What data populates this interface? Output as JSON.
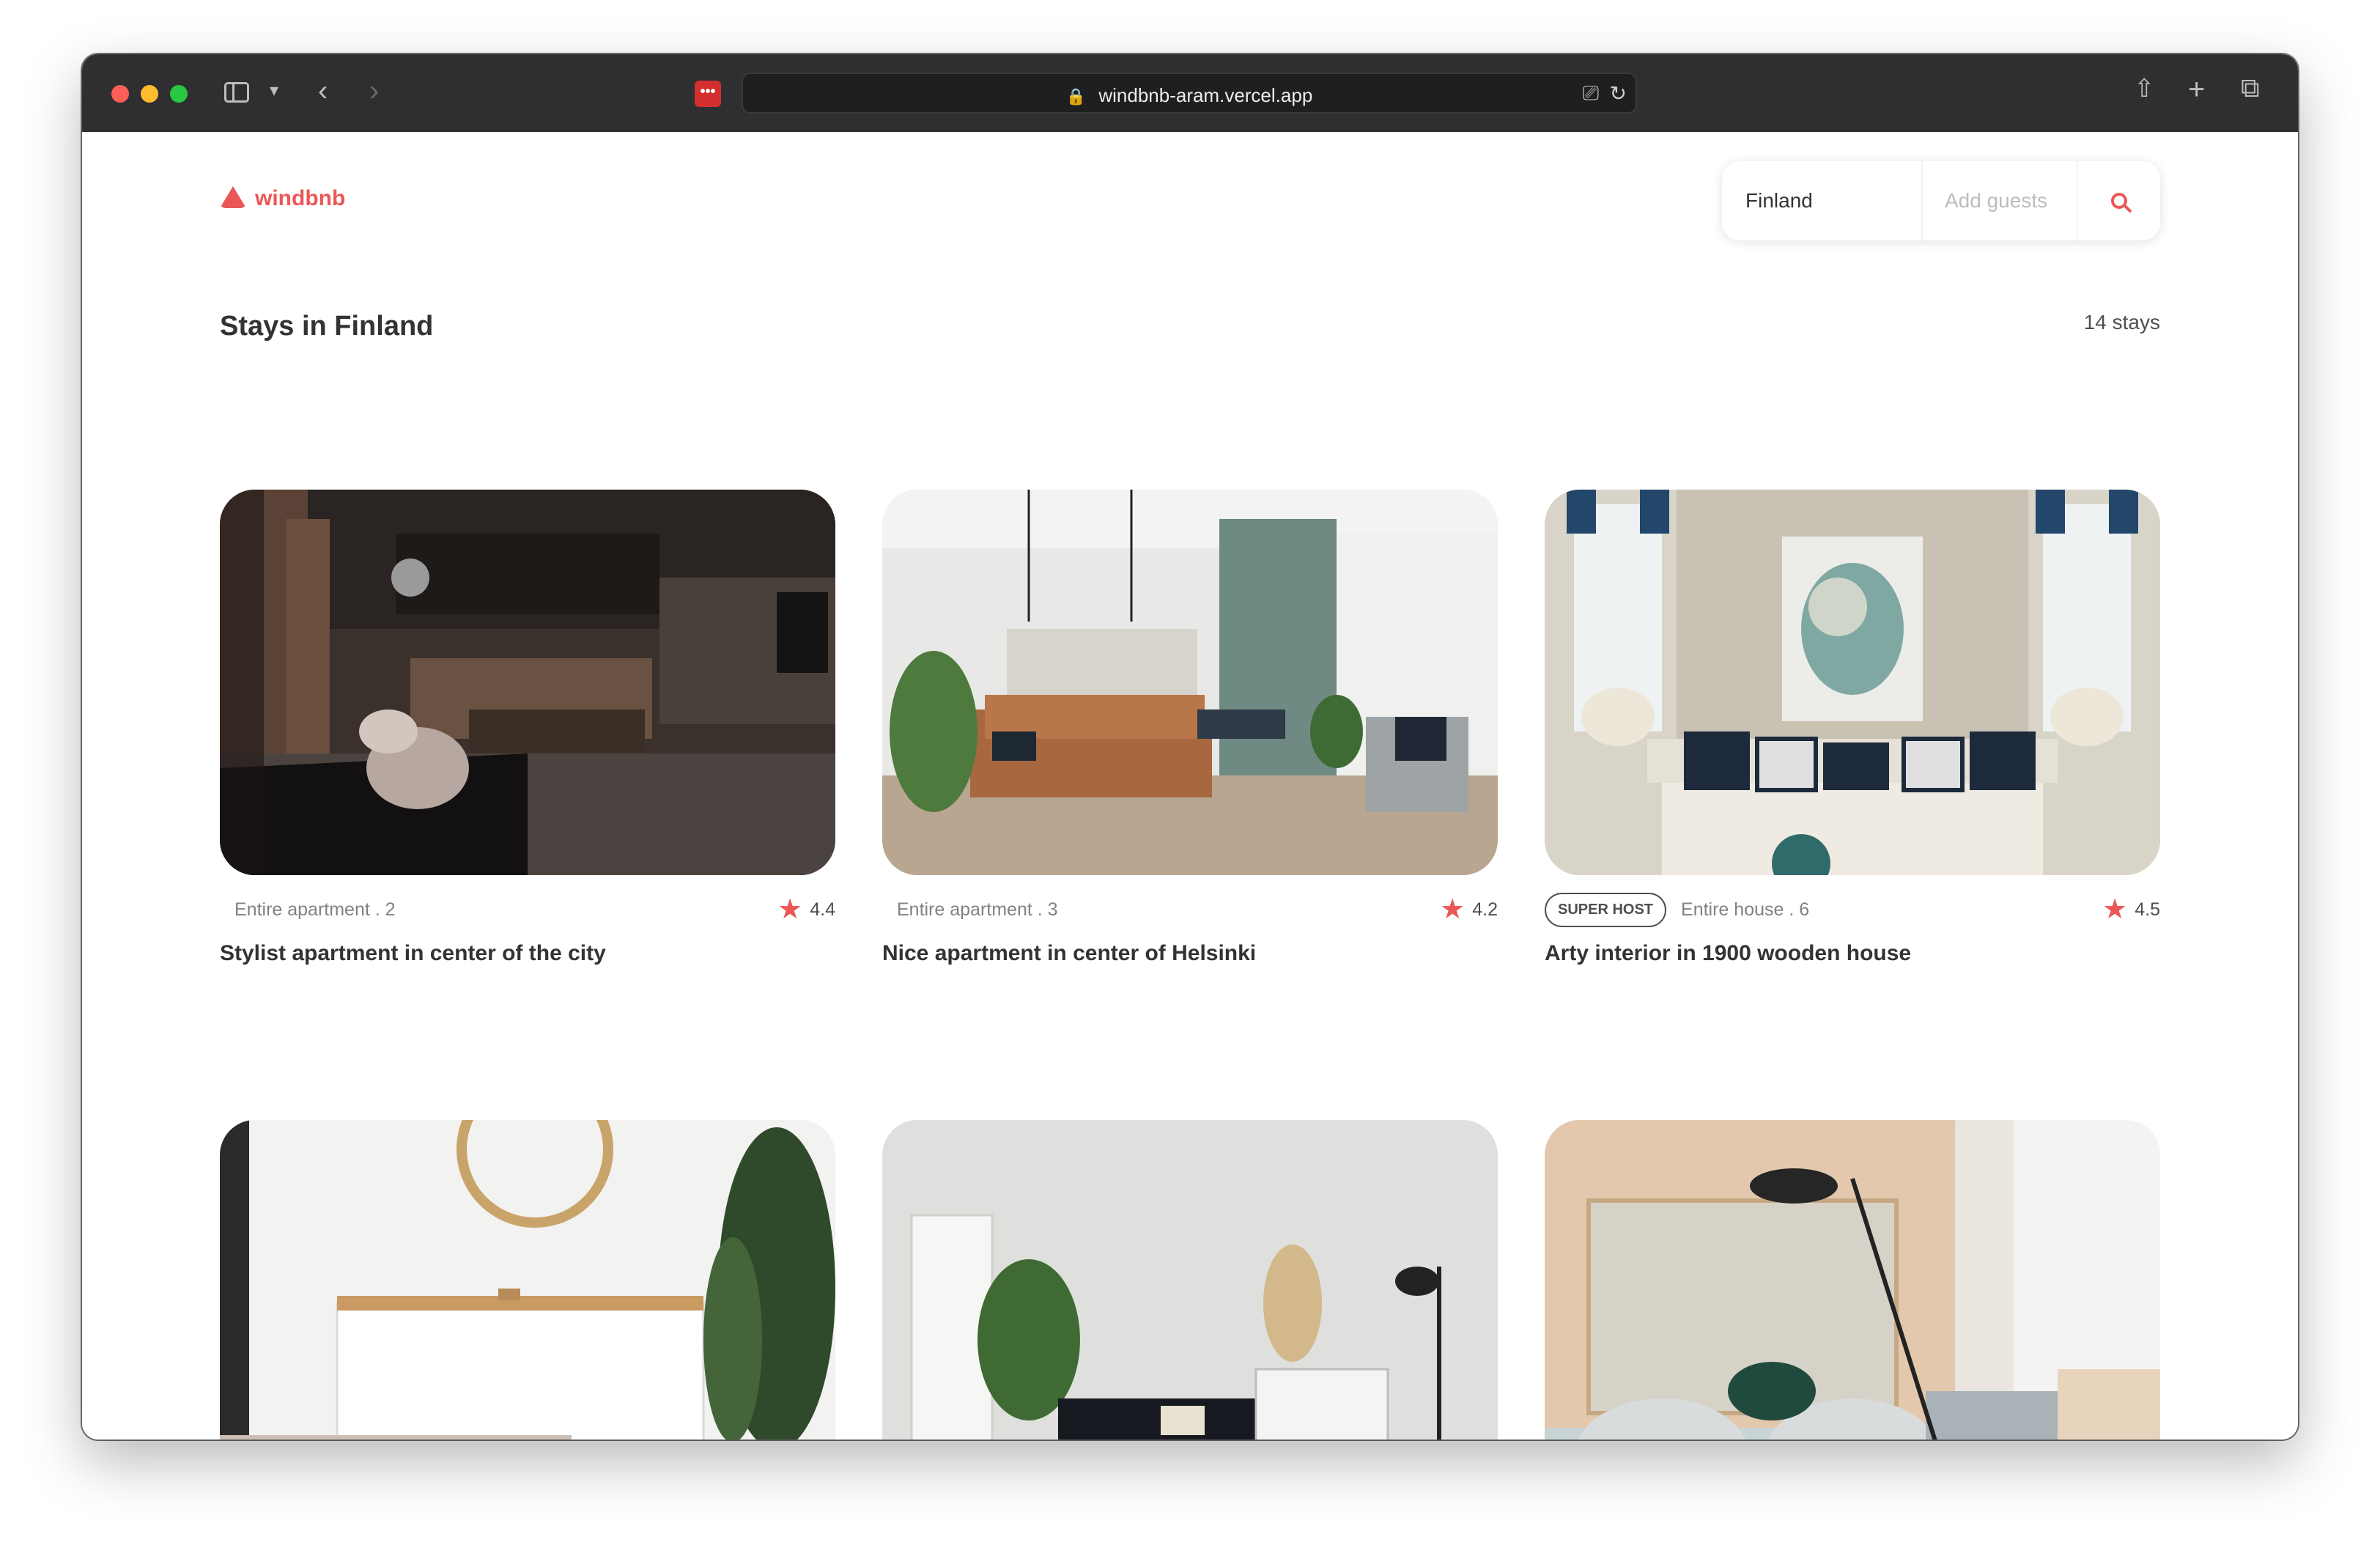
{
  "browser": {
    "url": "windbnb-aram.vercel.app"
  },
  "header": {
    "logo_text": "windbnb",
    "search": {
      "location": "Finland",
      "guests_placeholder": "Add guests"
    }
  },
  "main": {
    "title": "Stays in Finland",
    "count": "14 stays"
  },
  "stays": [
    {
      "type": "Entire apartment . 2",
      "rating": "4.4",
      "title": "Stylist apartment in center of the city",
      "superhost": ""
    },
    {
      "type": "Entire apartment . 3",
      "rating": "4.2",
      "title": "Nice apartment in center of Helsinki",
      "superhost": ""
    },
    {
      "type": "Entire house . 6",
      "rating": "4.5",
      "title": "Arty interior in 1900 wooden house",
      "superhost": "SUPER HOST"
    }
  ],
  "colors": {
    "accent": "#eb5757",
    "text": "#333333",
    "muted": "#828282"
  }
}
